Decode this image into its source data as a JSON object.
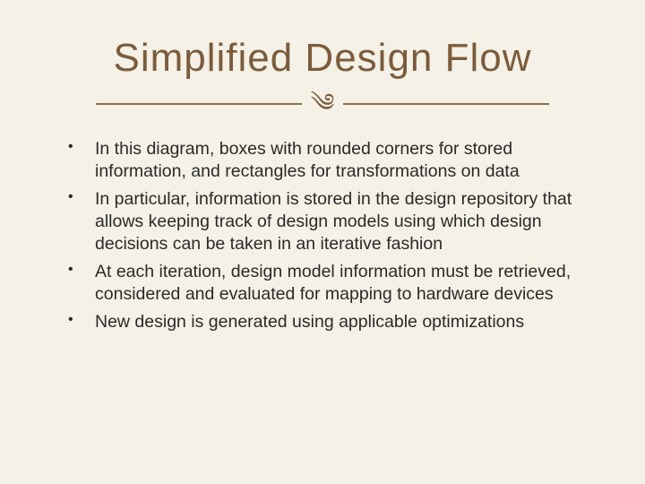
{
  "slide": {
    "title": "Simplified Design Flow",
    "ornament": "༄",
    "bullets": [
      "In this diagram, boxes with rounded corners for stored information, and rectangles for transformations on data",
      "In particular, information is stored in the  design repository that allows keeping track of design models using which design decisions can be taken in an  iterative fashion",
      "At each iteration, design model information must be retrieved, considered and evaluated for mapping to hardware devices",
      "New design is generated using applicable optimizations"
    ]
  }
}
